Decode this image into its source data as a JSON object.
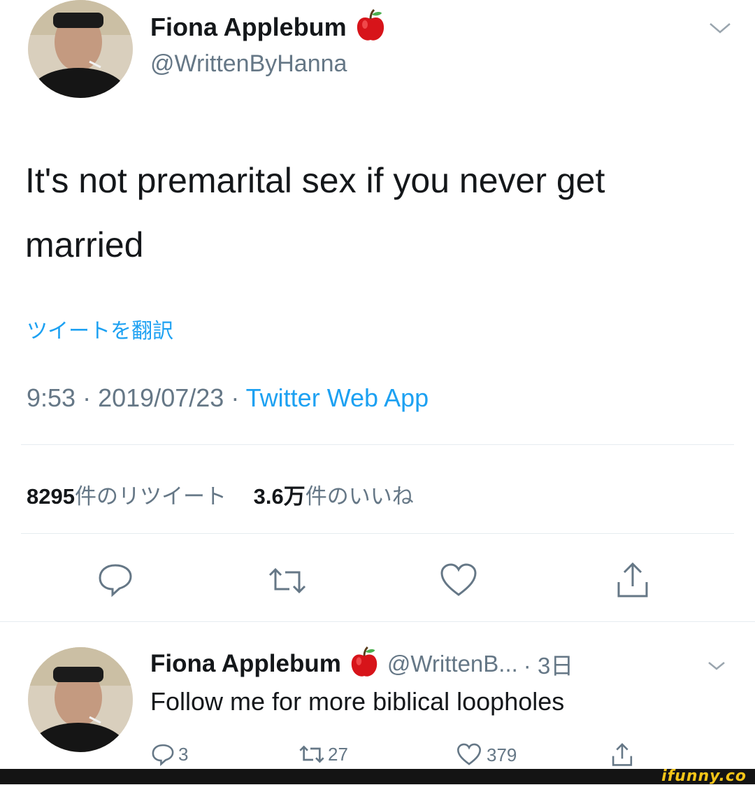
{
  "tweet": {
    "display_name": "Fiona Applebum",
    "handle": "@WrittenByHanna",
    "text": "It's not premarital sex if you never get married",
    "translate_link": "ツイートを翻訳",
    "time": "9:53",
    "date": "2019/07/23",
    "separator": "·",
    "source": "Twitter Web App",
    "retweet_count": "8295",
    "retweet_label": "件のリツイート",
    "like_count": "3.6万",
    "like_label": "件のいいね"
  },
  "reply": {
    "display_name": "Fiona Applebum",
    "handle": "@WrittenB...",
    "age": "· 3日",
    "text": "Follow me for more biblical loopholes",
    "reply_count": "3",
    "retweet_count": "27",
    "like_count": "379"
  },
  "watermark": "ifunny.co",
  "colors": {
    "link_blue": "#1da1f2",
    "text": "#14171a",
    "secondary": "#657786",
    "apple_red": "#d7141a"
  },
  "icons": [
    "chevron-down-icon",
    "apple-emoji-icon",
    "reply-icon",
    "retweet-icon",
    "like-icon",
    "share-icon"
  ]
}
